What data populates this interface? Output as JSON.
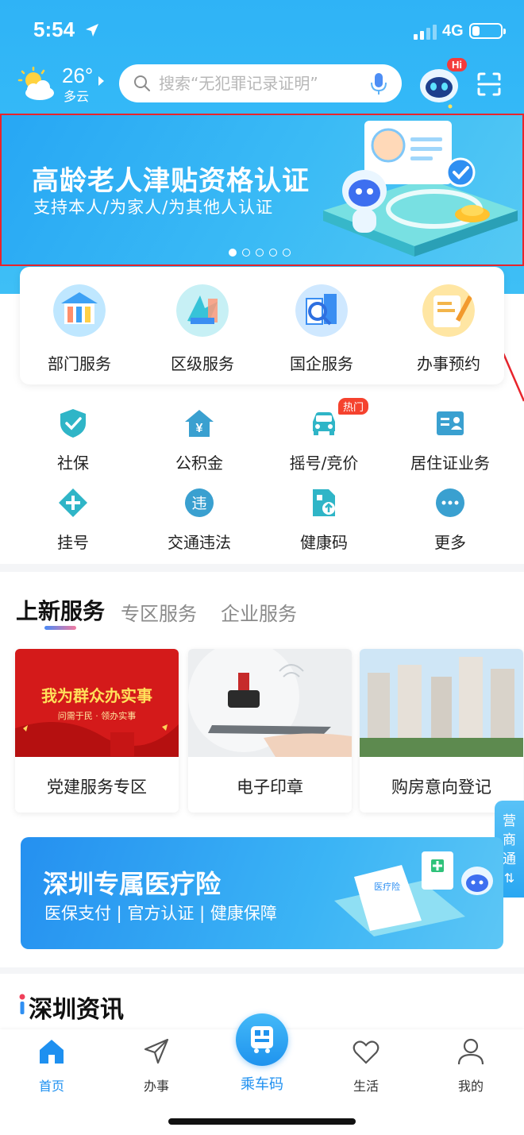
{
  "status_bar": {
    "time": "5:54",
    "network": "4G",
    "battery_percent": 25
  },
  "header": {
    "temperature": "26°",
    "weather": "多云",
    "search_placeholder": "搜索“无犯罪记录证明”",
    "robot_badge": "Hi"
  },
  "banner": {
    "title": "高龄老人津贴资格认证",
    "subtitle": "支持本人/为家人/为其他人认证",
    "slide_count": 5,
    "active_slide": 1
  },
  "service_card": [
    {
      "label": "部门服务",
      "icon": "department-icon"
    },
    {
      "label": "区级服务",
      "icon": "district-icon"
    },
    {
      "label": "国企服务",
      "icon": "soe-icon"
    },
    {
      "label": "办事预约",
      "icon": "appointment-icon"
    }
  ],
  "quick_grid": [
    {
      "label": "社保",
      "icon": "shield-check-icon"
    },
    {
      "label": "公积金",
      "icon": "house-yen-icon"
    },
    {
      "label": "摇号/竞价",
      "icon": "car-icon",
      "badge": "热门"
    },
    {
      "label": "居住证业务",
      "icon": "id-card-icon"
    },
    {
      "label": "挂号",
      "icon": "plus-diamond-icon"
    },
    {
      "label": "交通违法",
      "icon": "traffic-violation-icon",
      "glyph": "违"
    },
    {
      "label": "健康码",
      "icon": "health-code-icon"
    },
    {
      "label": "更多",
      "icon": "more-icon"
    }
  ],
  "section_tabs": {
    "active": "上新服务",
    "others": [
      "专区服务",
      "企业服务"
    ]
  },
  "feature_cards": [
    {
      "label": "党建服务专区",
      "image_text_main": "我为群众办实事",
      "image_text_sub": "问需于民 · 领办实事"
    },
    {
      "label": "电子印章"
    },
    {
      "label": "购房意向登记"
    }
  ],
  "side_tab": {
    "label": "营商通"
  },
  "medical_banner": {
    "title": "深圳专属医疗险",
    "subtitle": "医保支付 | 官方认证 | 健康保障",
    "doc_text": "医疗险"
  },
  "news": {
    "title": "深圳资讯"
  },
  "tab_bar": [
    {
      "label": "首页",
      "icon": "home-icon",
      "active": true
    },
    {
      "label": "办事",
      "icon": "send-icon"
    },
    {
      "label": "乘车码",
      "icon": "bus-qr-icon"
    },
    {
      "label": "生活",
      "icon": "heart-icon"
    },
    {
      "label": "我的",
      "icon": "user-icon"
    }
  ],
  "colors": {
    "accent": "#1e90f0",
    "hot_badge": "#f5422e",
    "banner_border": "#e8242c"
  }
}
